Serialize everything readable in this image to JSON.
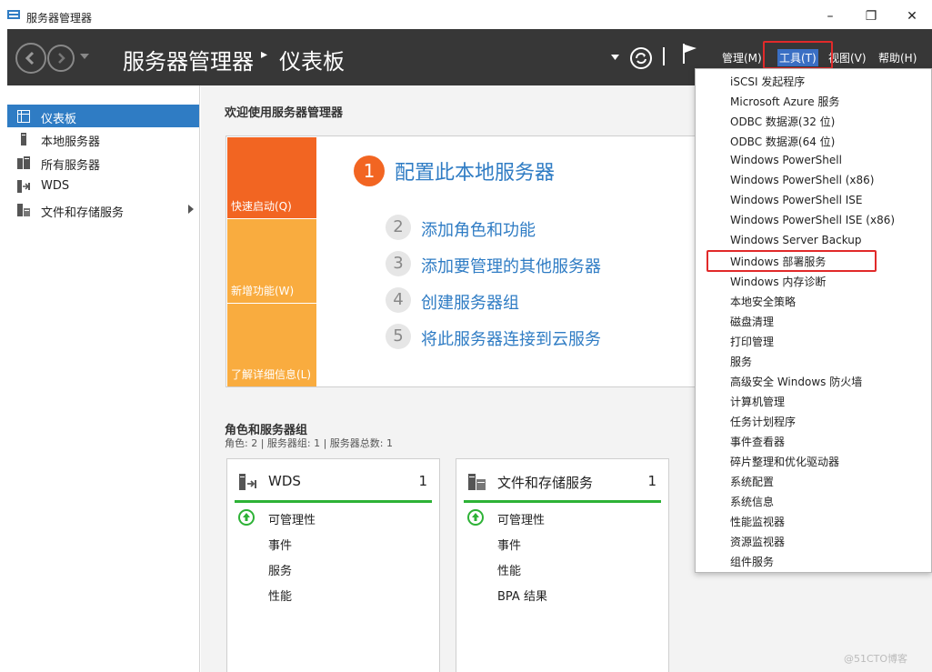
{
  "window": {
    "title": "服务器管理器",
    "minimize": "–",
    "restore": "❐",
    "close": "✕"
  },
  "header": {
    "breadcrumb_root": "服务器管理器",
    "breadcrumb_sep": "▸",
    "breadcrumb_page": "仪表板",
    "menus": {
      "manage": "管理(M)",
      "tools": "工具(T)",
      "view": "视图(V)",
      "help": "帮助(H)"
    }
  },
  "sidebar": {
    "items": [
      {
        "label": "仪表板",
        "icon": "dashboard-icon"
      },
      {
        "label": "本地服务器",
        "icon": "server-icon"
      },
      {
        "label": "所有服务器",
        "icon": "servers-icon"
      },
      {
        "label": "WDS",
        "icon": "wds-icon"
      },
      {
        "label": "文件和存储服务",
        "icon": "storage-icon"
      }
    ]
  },
  "main": {
    "welcome_title": "欢迎使用服务器管理器",
    "quickstart": {
      "tiles": [
        "快速启动(Q)",
        "新增功能(W)",
        "了解详细信息(L)"
      ],
      "steps": [
        {
          "num": "1",
          "label": "配置此本地服务器"
        },
        {
          "num": "2",
          "label": "添加角色和功能"
        },
        {
          "num": "3",
          "label": "添加要管理的其他服务器"
        },
        {
          "num": "4",
          "label": "创建服务器组"
        },
        {
          "num": "5",
          "label": "将此服务器连接到云服务"
        }
      ]
    },
    "roles_title": "角色和服务器组",
    "roles_sub": "角色: 2 | 服务器组: 1 | 服务器总数: 1",
    "cards": [
      {
        "title": "WDS",
        "count": "1",
        "rows": [
          "可管理性",
          "事件",
          "服务",
          "性能"
        ]
      },
      {
        "title": "文件和存储服务",
        "count": "1",
        "rows": [
          "可管理性",
          "事件",
          "性能",
          "BPA 结果"
        ]
      }
    ]
  },
  "tools_menu": {
    "items": [
      "iSCSI 发起程序",
      "Microsoft Azure 服务",
      "ODBC 数据源(32 位)",
      "ODBC 数据源(64 位)",
      "Windows PowerShell",
      "Windows PowerShell (x86)",
      "Windows PowerShell ISE",
      "Windows PowerShell ISE (x86)",
      "Windows Server Backup",
      "Windows 部署服务",
      "Windows 内存诊断",
      "本地安全策略",
      "磁盘清理",
      "打印管理",
      "服务",
      "高级安全 Windows 防火墙",
      "计算机管理",
      "任务计划程序",
      "事件查看器",
      "碎片整理和优化驱动器",
      "系统配置",
      "系统信息",
      "性能监视器",
      "资源监视器",
      "组件服务"
    ]
  },
  "watermark": "@51CTO博客",
  "colors": {
    "accent": "#2f7cc4",
    "header_bg": "#373737",
    "tile_orange": "#f26522",
    "tile_light_orange": "#f9ac3f",
    "status_green": "#2db236",
    "highlight_red": "#e12a2a"
  }
}
